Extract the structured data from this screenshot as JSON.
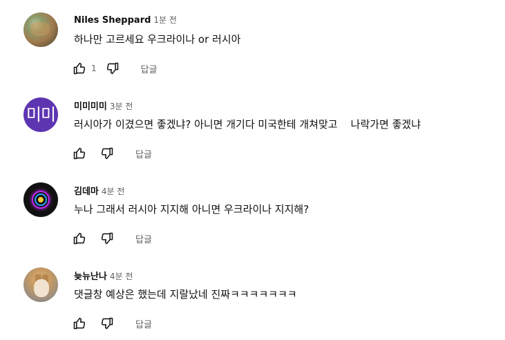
{
  "comments": [
    {
      "author": "Niles Sheppard",
      "time": "1분 전",
      "text": "하나만 고르세요 우크라이나 or 러시아",
      "likes": "1",
      "reply": "답글"
    },
    {
      "author": "미미미미",
      "time": "3분 전",
      "avatar_initials": "미미",
      "avatar_color": "#5e35b1",
      "text": "러시아가 이겼으면 좋겠냐? 아니면 개기다 미국한테 개쳐맞고    나락가면 좋겠냐",
      "reply": "답글"
    },
    {
      "author": "김데마",
      "time": "4분 전",
      "text": "누나 그래서 러시아 지지해 아니면 우크라이나 지지해?",
      "reply": "답글"
    },
    {
      "author": "늦뉴난나",
      "time": "4분 전",
      "text": "댓글창 예상은 했는데 지랄났네 진짜ㅋㅋㅋㅋㅋㅋㅋ",
      "reply": "답글"
    }
  ],
  "icons": {
    "like": "thumb-up-icon",
    "dislike": "thumb-down-icon"
  }
}
